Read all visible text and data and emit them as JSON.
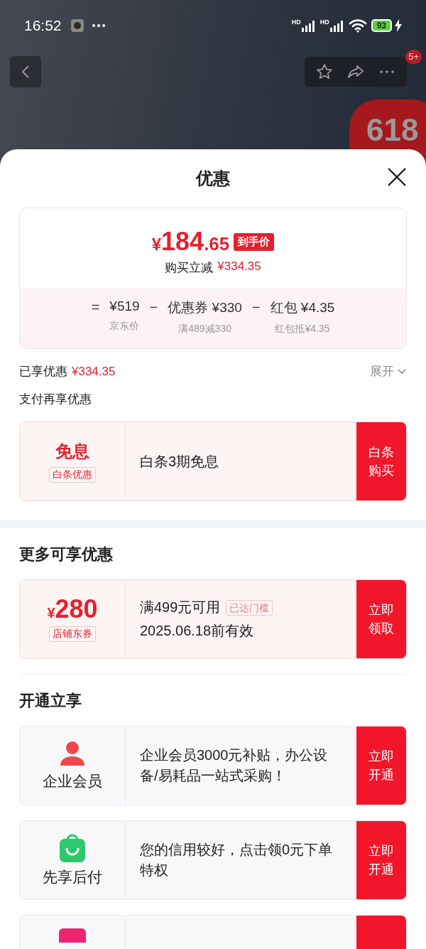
{
  "status_bar": {
    "time": "16:52",
    "signals": [
      {
        "label": "HD"
      },
      {
        "label": "HD"
      }
    ],
    "battery": "93",
    "charging": true
  },
  "nav": {
    "badge": "5+"
  },
  "banner": {
    "text": "618"
  },
  "sheet": {
    "title": "优惠"
  },
  "summary": {
    "currency": "¥",
    "price_int": "184",
    "price_dec": ".65",
    "price_tag": "到手价",
    "reduction_label": "购买立减",
    "reduction": "¥334.35",
    "breakdown": [
      {
        "op": "=",
        "value": "¥519",
        "note": "京东价"
      },
      {
        "op": "−",
        "label": "优惠券",
        "value": "¥330",
        "note": "满489减330"
      },
      {
        "op": "−",
        "label": "红包",
        "value": "¥4.35",
        "note": "红包抵¥4.35"
      }
    ]
  },
  "enjoyed": {
    "label": "已享优惠",
    "amount": "¥334.35",
    "toggle": "展开",
    "expanded": false
  },
  "pay_title": "支付再享优惠",
  "pay_offers": [
    {
      "kind": "interest_free",
      "title": "免息",
      "tag": "白条优惠",
      "text": "白条3期免息",
      "button": "白条购买"
    }
  ],
  "more_title": "更多可享优惠",
  "coupons": [
    {
      "kind": "coupon",
      "currency": "¥",
      "amount": "280",
      "tag": "店铺东券",
      "condition": "满499元可用",
      "status": "已达门槛",
      "validity": "2025.06.18前有效",
      "button": "立即领取"
    }
  ],
  "open_title": "开通立享",
  "services": [
    {
      "kind": "member",
      "title": "企业会员",
      "text": " 企业会员3000元补贴，办公设备/易耗品一站式采购！",
      "button": "立即开通"
    },
    {
      "kind": "pay_later",
      "title": "先享后付",
      "text": "您的信用较好，点击领0元下单特权",
      "button": "立即开通"
    },
    {
      "kind": "partial"
    }
  ]
}
